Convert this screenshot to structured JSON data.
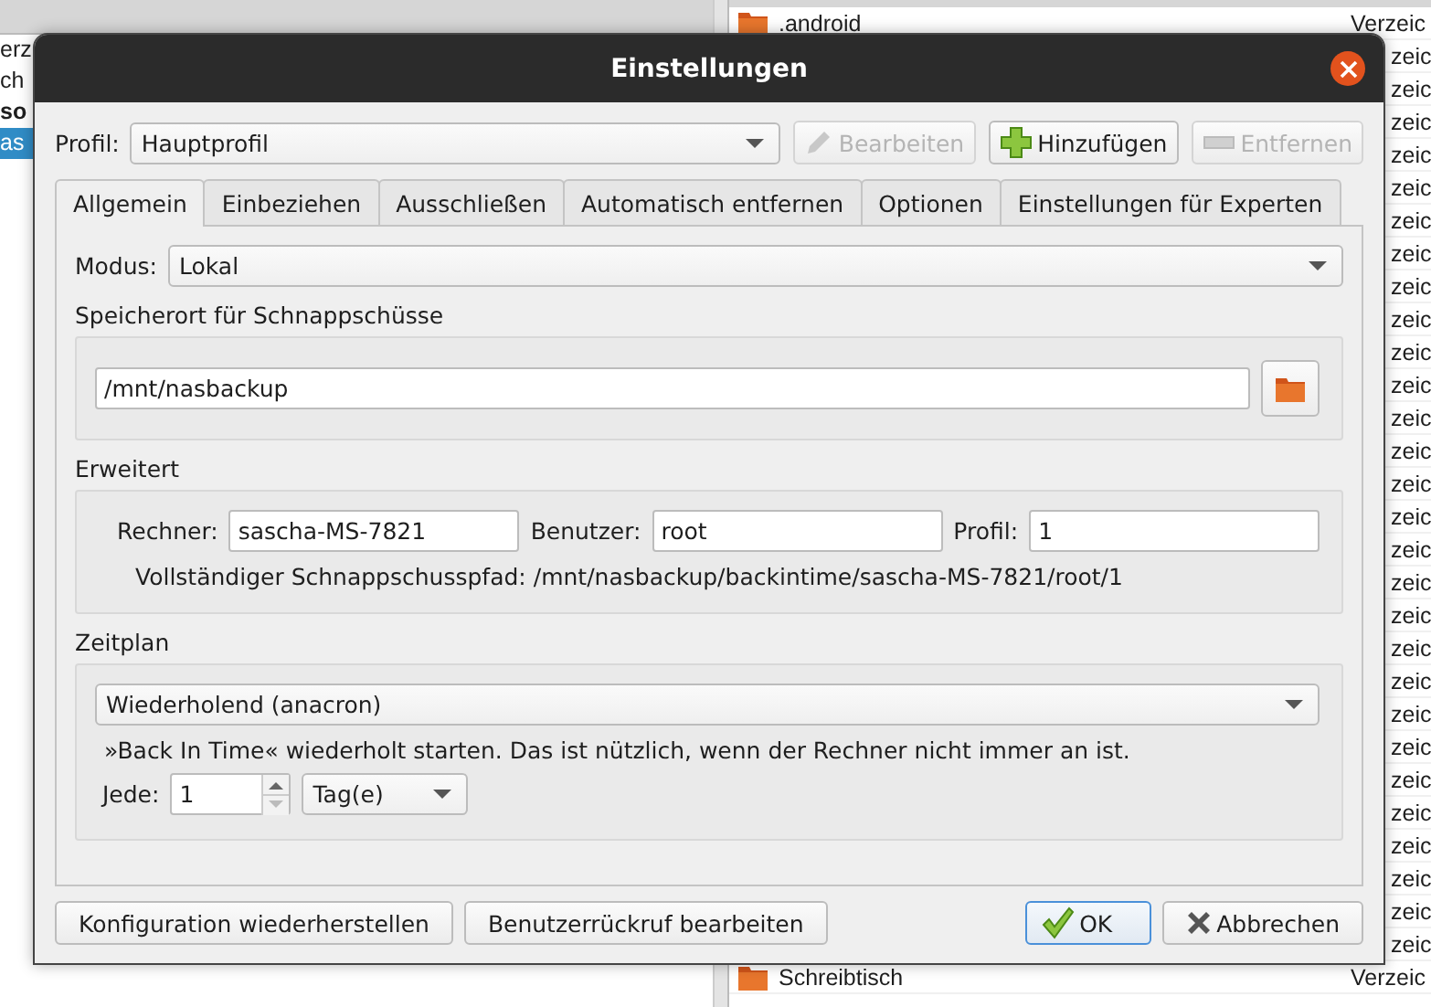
{
  "background": {
    "left_list": [
      {
        "text": "erz",
        "kind": "item",
        "selected": false
      },
      {
        "text": "ch",
        "kind": "item",
        "selected": false
      },
      {
        "text": "so",
        "kind": "group",
        "selected": false
      },
      {
        "text": "as",
        "kind": "item",
        "selected": true
      }
    ],
    "file_rows": [
      {
        "name": ".android",
        "type": "Verzeic"
      },
      {
        "type": "zeic"
      },
      {
        "type": "zeic"
      },
      {
        "type": "zeic"
      },
      {
        "type": "zeic"
      },
      {
        "type": "zeic"
      },
      {
        "type": "zeic"
      },
      {
        "type": "zeic"
      },
      {
        "type": "zeic"
      },
      {
        "type": "zeic"
      },
      {
        "type": "zeic"
      },
      {
        "type": "zeic"
      },
      {
        "type": "zeic"
      },
      {
        "type": "zeic"
      },
      {
        "type": "zeic"
      },
      {
        "type": "zeic"
      },
      {
        "type": "zeic"
      },
      {
        "type": "zeic"
      },
      {
        "type": "zeic"
      },
      {
        "type": "zeic"
      },
      {
        "type": "zeic"
      },
      {
        "type": "zeic"
      },
      {
        "type": "zeic"
      },
      {
        "type": "zeic"
      },
      {
        "type": "zeic"
      },
      {
        "type": "zeic"
      },
      {
        "type": "zeic"
      },
      {
        "type": "zeic"
      },
      {
        "type": "zeic"
      },
      {
        "name": "Schreibtisch",
        "type": "Verzeic"
      }
    ]
  },
  "window": {
    "title": "Einstellungen"
  },
  "profile": {
    "label": "Profil:",
    "value": "Hauptprofil",
    "buttons": [
      {
        "label": "Bearbeiten",
        "kind": "edit",
        "disabled": true
      },
      {
        "label": "Hinzufügen",
        "kind": "add",
        "disabled": false
      },
      {
        "label": "Entfernen",
        "kind": "remove",
        "disabled": true
      }
    ]
  },
  "tabs": [
    {
      "label": "Allgemein",
      "selected": true
    },
    {
      "label": "Einbeziehen",
      "selected": false
    },
    {
      "label": "Ausschließen",
      "selected": false
    },
    {
      "label": "Automatisch entfernen",
      "selected": false
    },
    {
      "label": "Optionen",
      "selected": false
    },
    {
      "label": "Einstellungen für Experten",
      "selected": false
    }
  ],
  "mode": {
    "label": "Modus:",
    "value": "Lokal"
  },
  "snapshot_location": {
    "title": "Speicherort für Schnappschüsse",
    "path": "/mnt/nasbackup"
  },
  "advanced": {
    "title": "Erweitert",
    "fields": [
      {
        "label": "Rechner:",
        "value": "sascha-MS-7821"
      },
      {
        "label": "Benutzer:",
        "value": "root"
      },
      {
        "label": "Profil:",
        "value": "1"
      }
    ],
    "full_path": "Vollständiger Schnappschusspfad: /mnt/nasbackup/backintime/sascha-MS-7821/root/1"
  },
  "schedule": {
    "title": "Zeitplan",
    "mode": "Wiederholend (anacron)",
    "note": "»Back In Time« wiederholt starten. Das ist nützlich, wenn der Rechner nicht immer an ist.",
    "every_label": "Jede:",
    "every_value": "1",
    "unit": "Tag(e)"
  },
  "footer": {
    "left_buttons": [
      {
        "label": "Konfiguration wiederherstellen"
      },
      {
        "label": "Benutzerrückruf bearbeiten"
      }
    ],
    "right_buttons": [
      {
        "label": "OK",
        "kind": "confirm",
        "default": true
      },
      {
        "label": "Abbrechen",
        "kind": "cancel",
        "default": false
      }
    ]
  }
}
